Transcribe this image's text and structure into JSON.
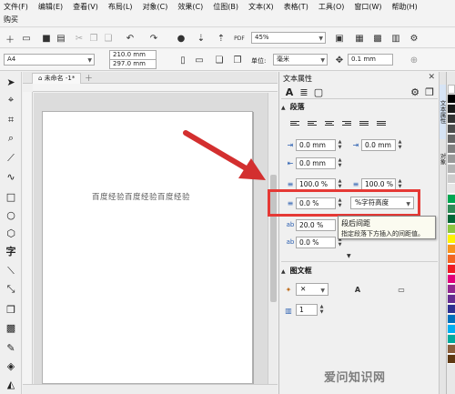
{
  "menu": {
    "row1": [
      "文件(F)",
      "编辑(E)",
      "查看(V)",
      "布局(L)",
      "对象(C)",
      "效果(C)",
      "位图(B)",
      "文本(X)",
      "表格(T)",
      "工具(O)",
      "窗口(W)",
      "帮助(H)"
    ],
    "row2": [
      "购买"
    ]
  },
  "toolbar": {
    "zoom_value": "45%",
    "pdf_label": "PDF"
  },
  "properties_bar": {
    "page_size": "A4",
    "width": "210.0 mm",
    "height": "297.0 mm",
    "unit_label": "单位:",
    "unit_value": "毫米",
    "nudge_value": "0.1 mm"
  },
  "document": {
    "tab_title": "未命名 -1*",
    "page_text": "百度经验百度经验百度经验"
  },
  "panel": {
    "title": "文本属性",
    "paragraph_section": "段落",
    "indent_left": "0.0 mm",
    "indent_first": "0.0 mm",
    "indent_right": "0.0 mm",
    "line_spacing": "100.0 %",
    "line_spacing_2": "100.0 %",
    "para_spacing_before": "0.0 %",
    "spacing_unit": "%字符高度",
    "char_spacing": "20.0 %",
    "word_spacing": "0.0 %",
    "frame_section": "图文框",
    "columns": "1"
  },
  "tooltip": {
    "title": "段后间距",
    "description": "指定段落下方插入的间距值。"
  },
  "side_tabs": [
    "文本属性",
    "对象"
  ],
  "watermark": "爱问知识网",
  "palette": [
    "#ffffff",
    "#000000",
    "#1a1a1a",
    "#333333",
    "#4d4d4d",
    "#666666",
    "#808080",
    "#999999",
    "#b3b3b3",
    "#cccccc",
    "#e6e6e6",
    "#00a651",
    "#2e8b57",
    "#006837",
    "#8dc63f",
    "#fff200",
    "#f7941d",
    "#f26522",
    "#ed1c24",
    "#e0007a",
    "#92278f",
    "#662d91",
    "#2e3192",
    "#0072bc",
    "#00aeef",
    "#00a99d",
    "#8b5e3c",
    "#603913"
  ],
  "colors": {
    "highlight": "#e53935",
    "arrow": "#d32f2f",
    "accent": "#2b5fb0"
  }
}
